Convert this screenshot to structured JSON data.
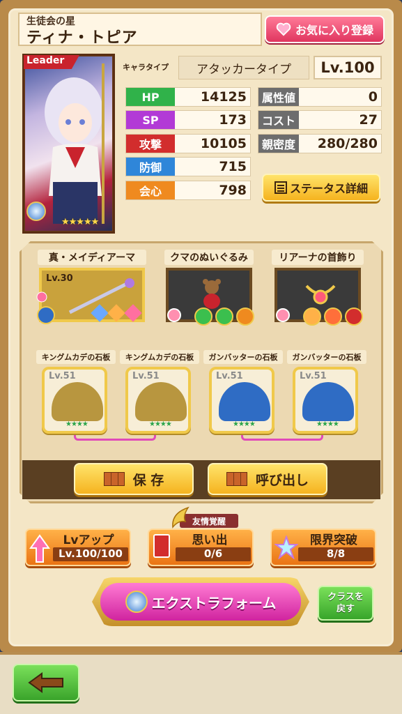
{
  "header": {
    "subtitle": "生徒会の星",
    "name": "ティナ・トピア",
    "favorite_label": "お気に入り登録"
  },
  "portrait": {
    "leader_label": "Leader",
    "stars": "★★★★★"
  },
  "character": {
    "type_label": "キャラタイプ",
    "type_value": "アタッカータイプ",
    "level": "Lv.100"
  },
  "stats_left": [
    {
      "label": "HP",
      "value": "14125"
    },
    {
      "label": "SP",
      "value": "173"
    },
    {
      "label": "攻撃",
      "value": "10105"
    },
    {
      "label": "防御",
      "value": "715"
    },
    {
      "label": "会心",
      "value": "798"
    }
  ],
  "stats_right": [
    {
      "label": "属性値",
      "value": "0"
    },
    {
      "label": "コスト",
      "value": "27"
    },
    {
      "label": "親密度",
      "value": "280/280"
    }
  ],
  "detail_button": "ステータス詳細",
  "equipment": [
    {
      "label": "真・メイディアーマ",
      "level": "Lv.30"
    },
    {
      "label": "クマのぬいぐるみ"
    },
    {
      "label": "リアーナの首飾り"
    }
  ],
  "stones": [
    {
      "label": "キングムカデの石板",
      "level": "Lv.51",
      "stars": "★★★★",
      "color": "#b8963f"
    },
    {
      "label": "キングムカデの石板",
      "level": "Lv.51",
      "stars": "★★★★",
      "color": "#b8963f"
    },
    {
      "label": "ガンバッターの石板",
      "level": "Lv.51",
      "stars": "★★★★",
      "color": "#2f6cc4"
    },
    {
      "label": "ガンバッターの石板",
      "level": "Lv.51",
      "stars": "★★★★",
      "color": "#2f6cc4"
    }
  ],
  "save_button": "保 存",
  "load_button": "呼び出し",
  "friend_tag": "友情覚醒",
  "lvup": {
    "title": "Lvアップ",
    "value": "Lv.100/100"
  },
  "memory": {
    "title": "思い出",
    "value": "0/6"
  },
  "limit": {
    "title": "限界突破",
    "value": "8/8"
  },
  "extra_form": "エクストラフォーム",
  "class_back": {
    "line1": "クラスを",
    "line2": "戻す"
  },
  "colors": {
    "accent": "#f5b31f",
    "favorite": "#e0355f",
    "extra": "#d0249f"
  }
}
